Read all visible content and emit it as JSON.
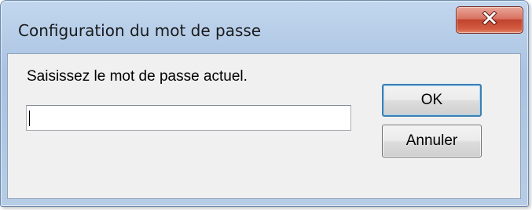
{
  "window": {
    "title": "Configuration du mot de passe",
    "close_icon": "close-x-icon"
  },
  "dialog": {
    "prompt": "Saisissez le mot de passe actuel.",
    "password_value": "",
    "ok_label": "OK",
    "cancel_label": "Annuler"
  },
  "colors": {
    "title_bar": "#b6cde8",
    "close_button": "#c1432e",
    "client_background": "#f0f0f0",
    "default_button_border": "#3c7fb1"
  }
}
